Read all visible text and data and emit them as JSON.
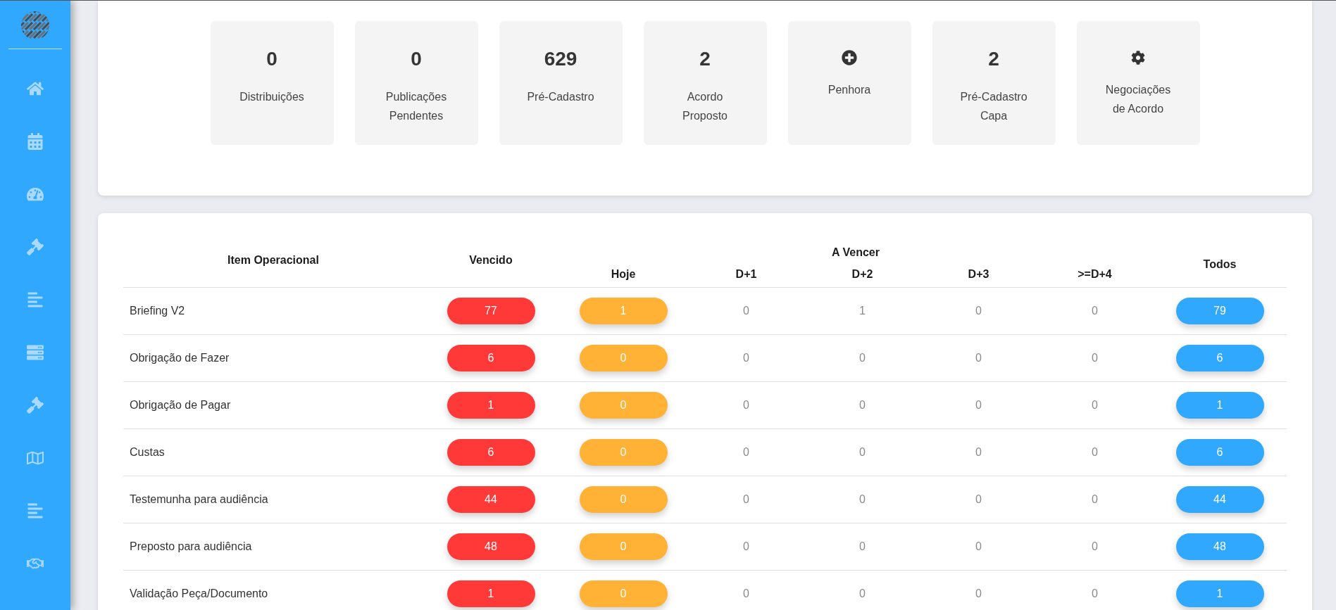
{
  "stats": [
    {
      "kind": "count",
      "value": "0",
      "label": "Distribuições"
    },
    {
      "kind": "count",
      "value": "0",
      "label": "Publicações Pendentes"
    },
    {
      "kind": "count",
      "value": "629",
      "label": "Pré-Cadastro"
    },
    {
      "kind": "count",
      "value": "2",
      "label": "Acordo Proposto"
    },
    {
      "kind": "plus",
      "label": "Penhora"
    },
    {
      "kind": "count",
      "value": "2",
      "label": "Pré-Cadastro Capa"
    },
    {
      "kind": "gear",
      "label": "Negociações de Acordo"
    }
  ],
  "table": {
    "columns": {
      "item": "Item Operacional",
      "overdue": "Vencido",
      "due_group": "A Vencer",
      "due": [
        "Hoje",
        "D+1",
        "D+2",
        "D+3",
        ">=D+4"
      ],
      "total": "Todos"
    },
    "rows": [
      {
        "item": "Briefing V2",
        "overdue": "77",
        "today": "1",
        "upcoming": [
          "0",
          "1",
          "0",
          "0"
        ],
        "total": "79"
      },
      {
        "item": "Obrigação de Fazer",
        "overdue": "6",
        "today": "0",
        "upcoming": [
          "0",
          "0",
          "0",
          "0"
        ],
        "total": "6"
      },
      {
        "item": "Obrigação de Pagar",
        "overdue": "1",
        "today": "0",
        "upcoming": [
          "0",
          "0",
          "0",
          "0"
        ],
        "total": "1"
      },
      {
        "item": "Custas",
        "overdue": "6",
        "today": "0",
        "upcoming": [
          "0",
          "0",
          "0",
          "0"
        ],
        "total": "6"
      },
      {
        "item": "Testemunha para audiência",
        "overdue": "44",
        "today": "0",
        "upcoming": [
          "0",
          "0",
          "0",
          "0"
        ],
        "total": "44"
      },
      {
        "item": "Preposto para audiência",
        "overdue": "48",
        "today": "0",
        "upcoming": [
          "0",
          "0",
          "0",
          "0"
        ],
        "total": "48"
      },
      {
        "item": "Validação Peça/Documento",
        "overdue": "1",
        "today": "0",
        "upcoming": [
          "0",
          "0",
          "0",
          "0"
        ],
        "total": "1"
      }
    ]
  }
}
